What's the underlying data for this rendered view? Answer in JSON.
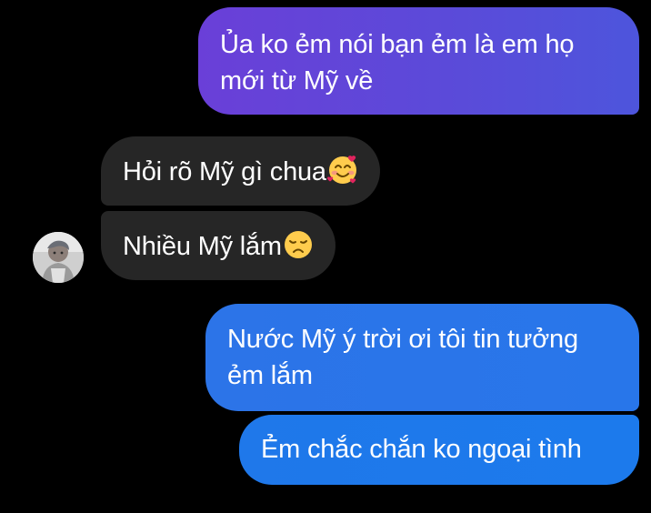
{
  "conversation": {
    "messages": [
      {
        "sender": "me",
        "text": "Ủa ko ẻm nói bạn ẻm là em họ mới từ Mỹ về"
      },
      {
        "sender": "them",
        "text": "Hỏi rõ Mỹ gì chua",
        "emoji": "smiling-face-with-hearts-emoji"
      },
      {
        "sender": "them",
        "text": "Nhiều Mỹ lắm",
        "emoji": "disappointed-face-emoji"
      },
      {
        "sender": "me",
        "text": "Nước Mỹ ý trời ơi tôi tin tưởng ẻm lắm"
      },
      {
        "sender": "me",
        "text": "Ẻm chắc chắn ko ngoại tình"
      }
    ],
    "line_breaks": {
      "m0": [
        "Ủa ko ẻm nói bạn ẻm là em họ",
        "mới từ Mỹ về"
      ],
      "m3": [
        "Nước Mỹ ý trời ơi tôi tin tưởng",
        "ẻm lắm"
      ]
    },
    "contact_avatar": "avatar-photo"
  },
  "colors": {
    "background": "#000000",
    "sent_gradient_start": "#6a3fd8",
    "sent_gradient_end": "#2876ea",
    "received_bubble": "#262626",
    "text": "#ffffff"
  }
}
